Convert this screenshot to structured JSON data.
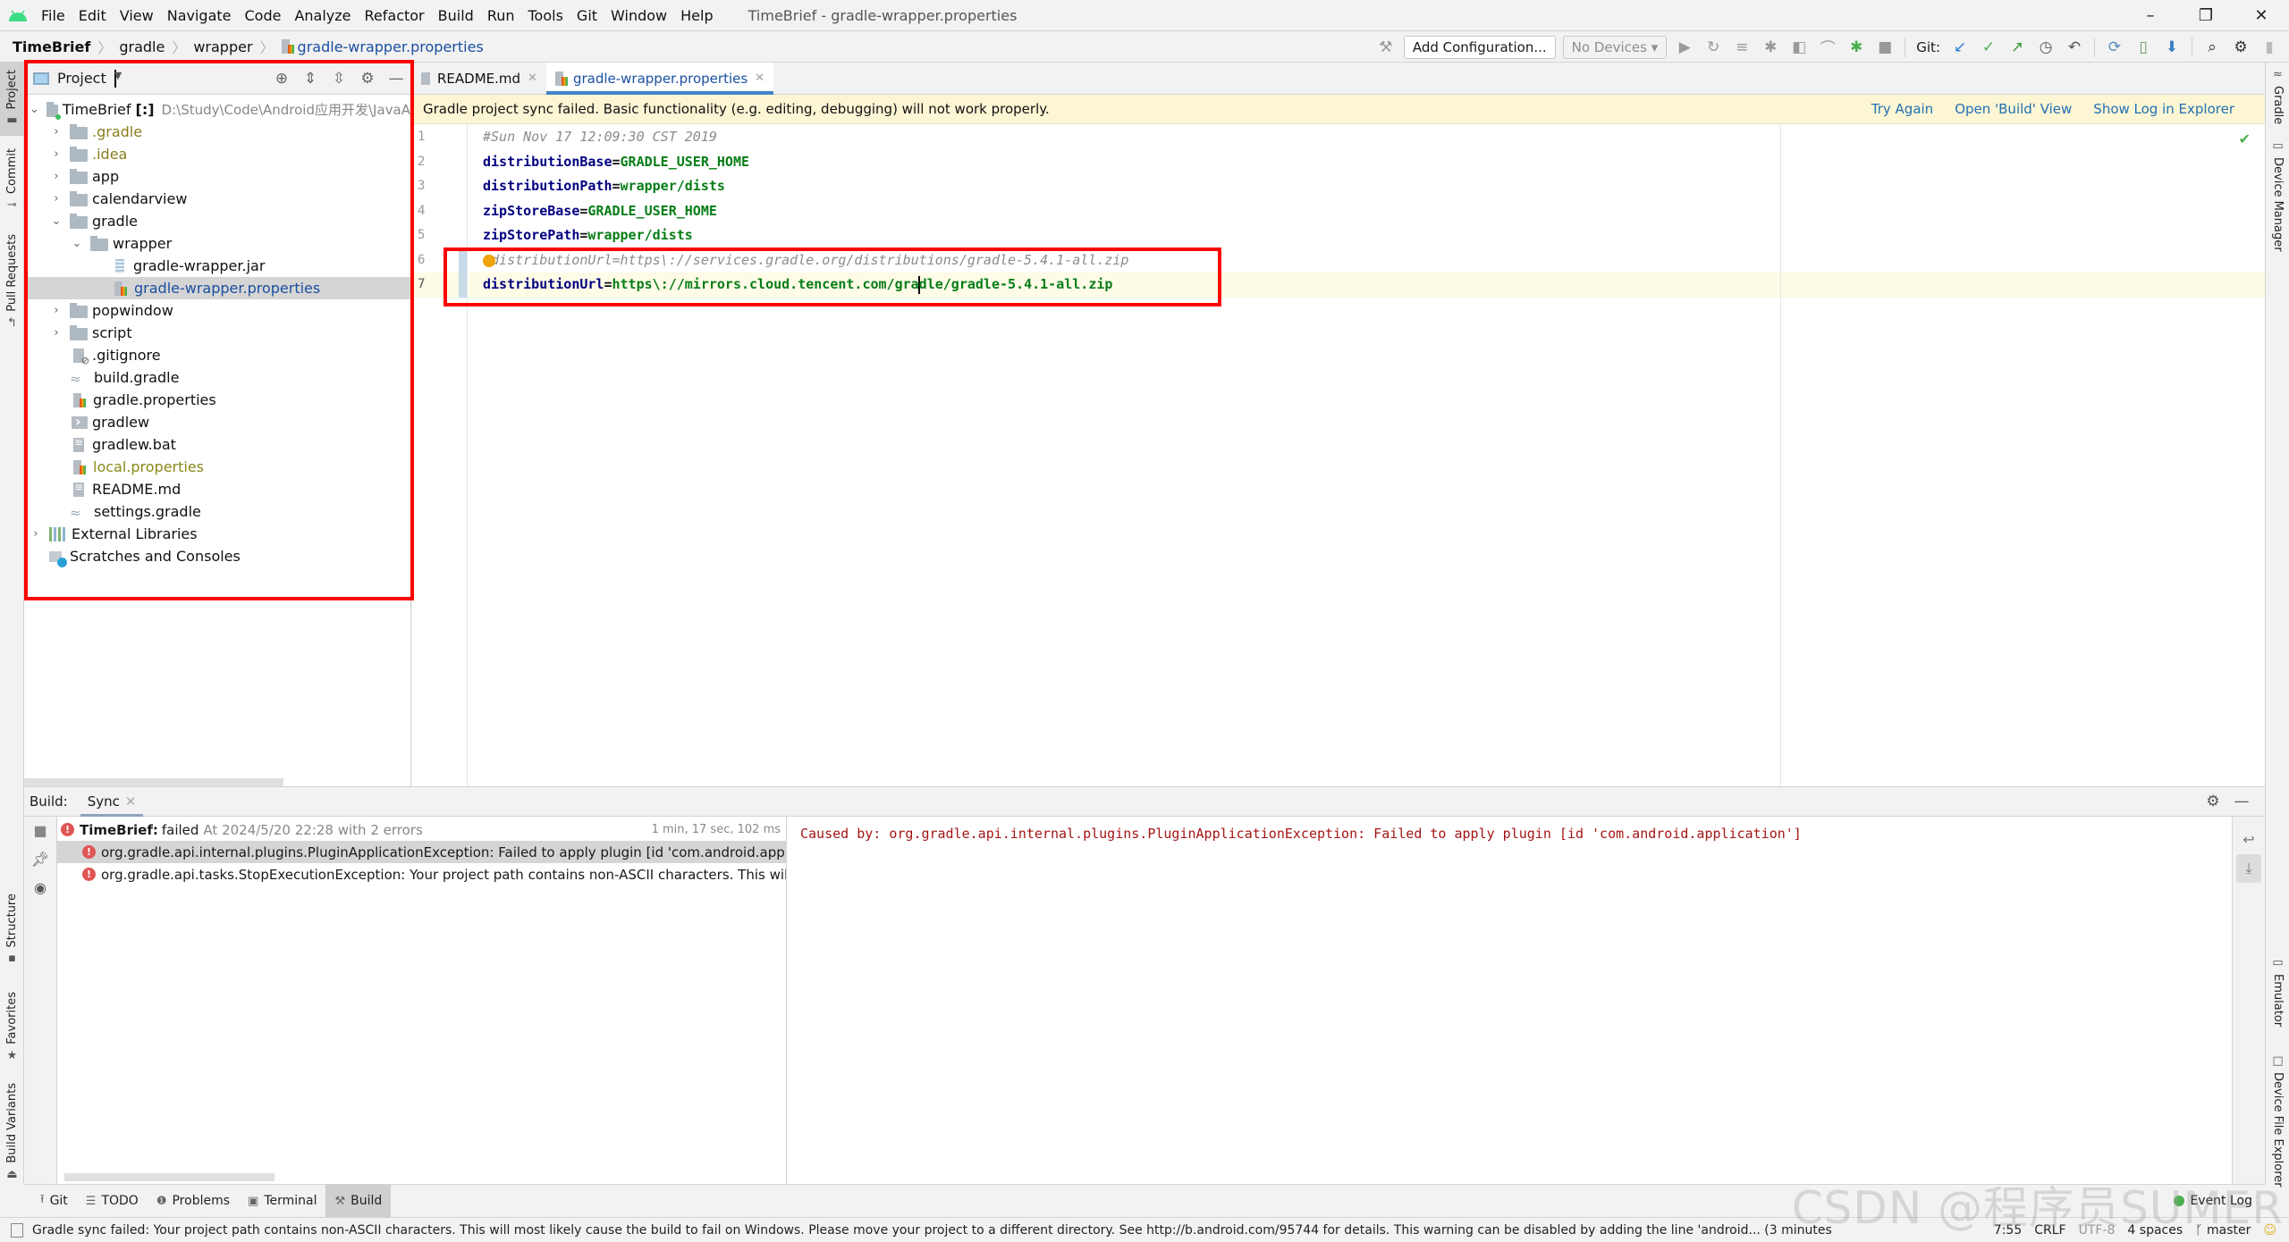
{
  "window": {
    "title": "TimeBrief - gradle-wrapper.properties",
    "controls": [
      "–",
      "❐",
      "✕"
    ]
  },
  "menu": [
    "File",
    "Edit",
    "View",
    "Navigate",
    "Code",
    "Analyze",
    "Refactor",
    "Build",
    "Run",
    "Tools",
    "Git",
    "Window",
    "Help"
  ],
  "breadcrumb": [
    "TimeBrief",
    "gradle",
    "wrapper",
    "gradle-wrapper.properties"
  ],
  "toolbar": {
    "add_config": "Add Configuration...",
    "devices": "No Devices",
    "git_label": "Git:"
  },
  "left_stripe": [
    "Project",
    "Commit",
    "Pull Requests",
    "Structure",
    "Favorites",
    "Build Variants"
  ],
  "right_stripe": [
    "Gradle",
    "Device Manager",
    "Emulator",
    "Device File Explorer"
  ],
  "project": {
    "title": "Project",
    "root": {
      "label": "TimeBrief",
      "badge": "[:]",
      "path": "D:\\Study\\Code\\Android应用开发\\JavaA"
    },
    "items": [
      {
        "label": ".gradle",
        "type": "folder"
      },
      {
        "label": ".idea",
        "type": "folder"
      },
      {
        "label": "app",
        "type": "folder"
      },
      {
        "label": "calendarview",
        "type": "folder"
      },
      {
        "label": "gradle",
        "type": "folder"
      },
      {
        "label": "wrapper",
        "type": "folder"
      },
      {
        "label": "gradle-wrapper.jar",
        "type": "jar"
      },
      {
        "label": "gradle-wrapper.properties",
        "type": "properties"
      },
      {
        "label": "popwindow",
        "type": "folder"
      },
      {
        "label": "script",
        "type": "folder"
      },
      {
        "label": ".gitignore",
        "type": "gitignore"
      },
      {
        "label": "build.gradle",
        "type": "gradle"
      },
      {
        "label": "gradle.properties",
        "type": "properties"
      },
      {
        "label": "gradlew",
        "type": "shell"
      },
      {
        "label": "gradlew.bat",
        "type": "file"
      },
      {
        "label": "local.properties",
        "type": "properties"
      },
      {
        "label": "README.md",
        "type": "file"
      },
      {
        "label": "settings.gradle",
        "type": "gradle"
      },
      {
        "label": "External Libraries",
        "type": "libs"
      },
      {
        "label": "Scratches and Consoles",
        "type": "scratch"
      }
    ]
  },
  "editor": {
    "tabs": [
      {
        "label": "README.md",
        "active": false
      },
      {
        "label": "gradle-wrapper.properties",
        "active": true
      }
    ],
    "banner": {
      "message": "Gradle project sync failed. Basic functionality (e.g. editing, debugging) will not work properly.",
      "links": [
        "Try Again",
        "Open 'Build' View",
        "Show Log in Explorer"
      ]
    },
    "line_numbers": [
      "1",
      "2",
      "3",
      "4",
      "5",
      "6",
      "7"
    ],
    "lines": [
      {
        "comment": "#Sun Nov 17 12:09:30 CST 2019"
      },
      {
        "key": "distributionBase",
        "value": "GRADLE_USER_HOME"
      },
      {
        "key": "distributionPath",
        "value": "wrapper/dists"
      },
      {
        "key": "zipStoreBase",
        "value": "GRADLE_USER_HOME"
      },
      {
        "key": "zipStorePath",
        "value": "wrapper/dists"
      },
      {
        "comment": "#distributionUrl=https\\://services.gradle.org/distributions/gradle-5.4.1-all.zip"
      },
      {
        "key": "distributionUrl",
        "value_a": "https\\://mirrors.cloud.tencent.com/gra",
        "value_b": "dle/gradle-5.4.1-all.zip"
      }
    ]
  },
  "build": {
    "label": "Build:",
    "tab": "Sync",
    "summary": {
      "project": "TimeBrief:",
      "status": "failed",
      "detail": "At 2024/5/20 22:28 with 2 errors",
      "duration": "1 min, 17 sec, 102 ms"
    },
    "errors": [
      "org.gradle.api.internal.plugins.PluginApplicationException: Failed to apply plugin [id 'com.android.application']",
      "org.gradle.api.tasks.StopExecutionException: Your project path contains non-ASCII characters. This will most likely cause the build to fail"
    ],
    "console": "Caused by: org.gradle.api.internal.plugins.PluginApplicationException: Failed to apply plugin [id 'com.android.application']"
  },
  "tool_tabs": [
    {
      "label": "Git",
      "icon": "⭱"
    },
    {
      "label": "TODO",
      "icon": "☰"
    },
    {
      "label": "Problems",
      "icon": "❶"
    },
    {
      "label": "Terminal",
      "icon": "▣"
    },
    {
      "label": "Build",
      "icon": "⚒"
    }
  ],
  "event_log": "Event Log",
  "status": {
    "message": "Gradle sync failed: Your project path contains non-ASCII characters. This will most likely cause the build to fail on Windows. Please move your project to a different directory. See http://b.android.com/95744 for details. This warning can be disabled by adding the line 'android... (3 minutes",
    "position": "7:55",
    "line_sep": "CRLF",
    "encoding": "UTF-8",
    "indent": "4 spaces",
    "branch": "master"
  },
  "watermark": "CSDN @程序员SUMER"
}
